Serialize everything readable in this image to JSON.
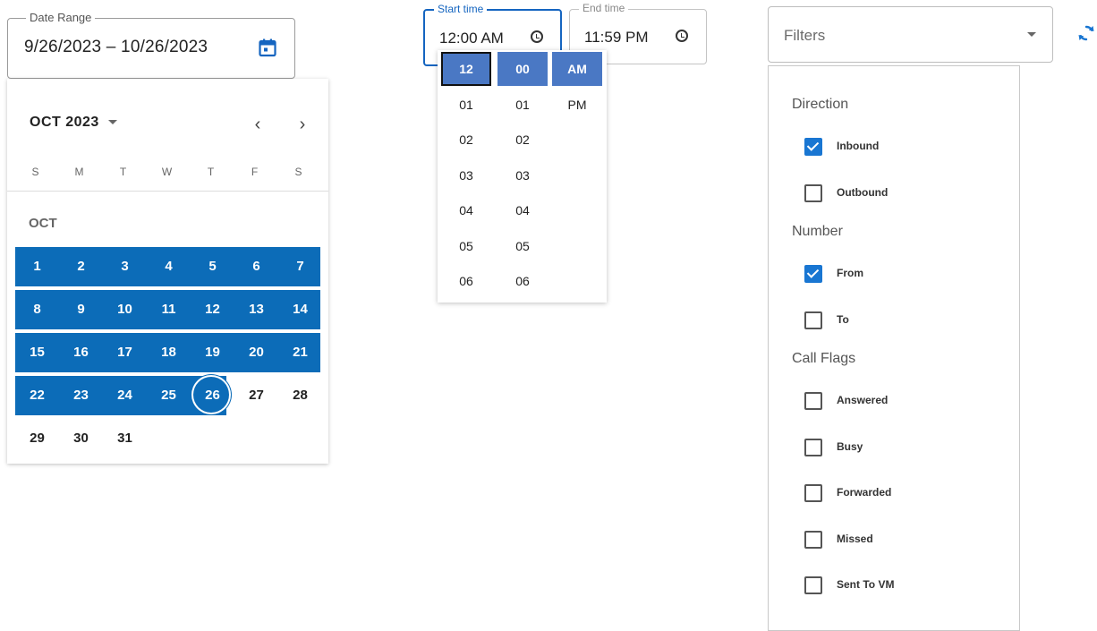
{
  "date_range": {
    "legend": "Date Range",
    "value": "9/26/2023  – 10/26/2023",
    "calendar_icon": "calendar-icon"
  },
  "calendar": {
    "month_year": "OCT 2023",
    "month_label": "OCT",
    "weekdays": [
      "S",
      "M",
      "T",
      "W",
      "T",
      "F",
      "S"
    ],
    "weeks": [
      [
        "1",
        "2",
        "3",
        "4",
        "5",
        "6",
        "7"
      ],
      [
        "8",
        "9",
        "10",
        "11",
        "12",
        "13",
        "14"
      ],
      [
        "15",
        "16",
        "17",
        "18",
        "19",
        "20",
        "21"
      ],
      [
        "22",
        "23",
        "24",
        "25",
        "26",
        "27",
        "28"
      ],
      [
        "29",
        "30",
        "31"
      ]
    ],
    "range_end_day": "26",
    "prev_icon": "chevron-left-icon",
    "next_icon": "chevron-right-icon"
  },
  "start_time": {
    "legend": "Start time",
    "value": "12:00 AM"
  },
  "end_time": {
    "legend": "End time",
    "value": "11:59 PM"
  },
  "time_picker": {
    "hours": [
      "12",
      "01",
      "02",
      "03",
      "04",
      "05",
      "06"
    ],
    "minutes": [
      "00",
      "01",
      "02",
      "03",
      "04",
      "05",
      "06"
    ],
    "meridiem": [
      "AM",
      "PM"
    ],
    "selected": {
      "hour": "12",
      "minute": "00",
      "meridiem": "AM"
    }
  },
  "filters": {
    "placeholder": "Filters",
    "refresh_icon": "refresh-icon",
    "groups": [
      {
        "title": "Direction",
        "options": [
          {
            "label": "Inbound",
            "checked": true
          },
          {
            "label": "Outbound",
            "checked": false
          }
        ]
      },
      {
        "title": "Number",
        "options": [
          {
            "label": "From",
            "checked": true
          },
          {
            "label": "To",
            "checked": false
          }
        ]
      },
      {
        "title": "Call Flags",
        "options": [
          {
            "label": "Answered",
            "checked": false
          },
          {
            "label": "Busy",
            "checked": false
          },
          {
            "label": "Forwarded",
            "checked": false
          },
          {
            "label": "Missed",
            "checked": false
          },
          {
            "label": "Sent To VM",
            "checked": false
          }
        ]
      }
    ]
  },
  "colors": {
    "range": "#0c6cb8",
    "time_selected": "#4a78c4",
    "checkbox": "#1976d2",
    "accent": "#1565c0"
  }
}
